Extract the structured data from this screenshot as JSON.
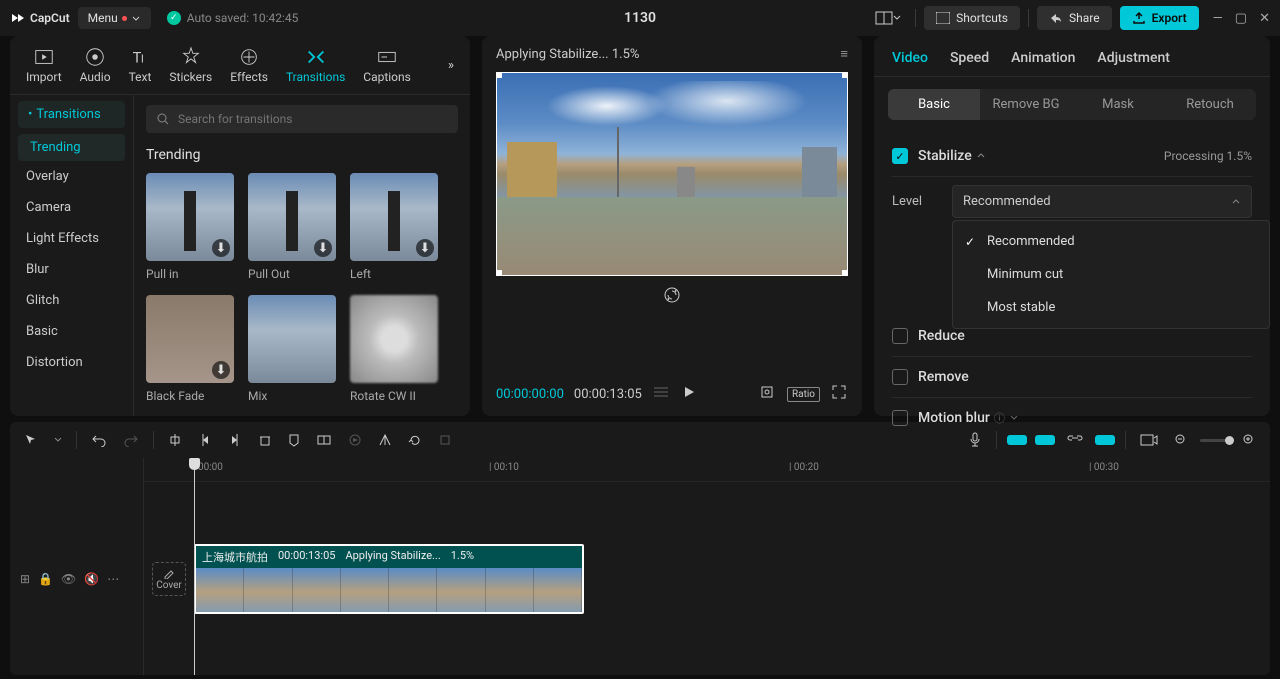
{
  "app": {
    "name": "CapCut",
    "menu_label": "Menu",
    "autosave": "Auto saved: 10:42:45",
    "project_title": "1130"
  },
  "topbar": {
    "shortcuts": "Shortcuts",
    "share": "Share",
    "export": "Export"
  },
  "media_tabs": [
    "Import",
    "Audio",
    "Text",
    "Stickers",
    "Effects",
    "Transitions",
    "Captions"
  ],
  "media_tabs_active": 5,
  "left": {
    "header": "Transitions",
    "search_placeholder": "Search for transitions",
    "categories": [
      "Trending",
      "Overlay",
      "Camera",
      "Light Effects",
      "Blur",
      "Glitch",
      "Basic",
      "Distortion"
    ],
    "active_category": 0,
    "section": "Trending",
    "items": [
      "Pull in",
      "Pull Out",
      "Left",
      "Black Fade",
      "Mix",
      "Rotate CW II"
    ]
  },
  "preview": {
    "status": "Applying Stabilize... 1.5%",
    "time_current": "00:00:00:00",
    "time_total": "00:00:13:05",
    "ratio": "Ratio"
  },
  "right": {
    "tabs": [
      "Video",
      "Speed",
      "Animation",
      "Adjustment"
    ],
    "active_tab": 0,
    "subtabs": [
      "Basic",
      "Remove BG",
      "Mask",
      "Retouch"
    ],
    "active_subtab": 0,
    "stabilize": {
      "label": "Stabilize",
      "processing": "Processing 1.5%",
      "level_label": "Level",
      "level_value": "Recommended",
      "options": [
        "Recommended",
        "Minimum cut",
        "Most stable"
      ],
      "selected": 0
    },
    "reduce": "Reduce",
    "remove": "Remove",
    "motion_blur": "Motion blur"
  },
  "timeline": {
    "marks": [
      "00:00",
      "| 00:10",
      "| 00:20",
      "| 00:30"
    ],
    "clip": {
      "name": "上海城市航拍",
      "duration": "00:00:13:05",
      "status": "Applying Stabilize...",
      "pct": "1.5%"
    },
    "cover": "Cover"
  }
}
